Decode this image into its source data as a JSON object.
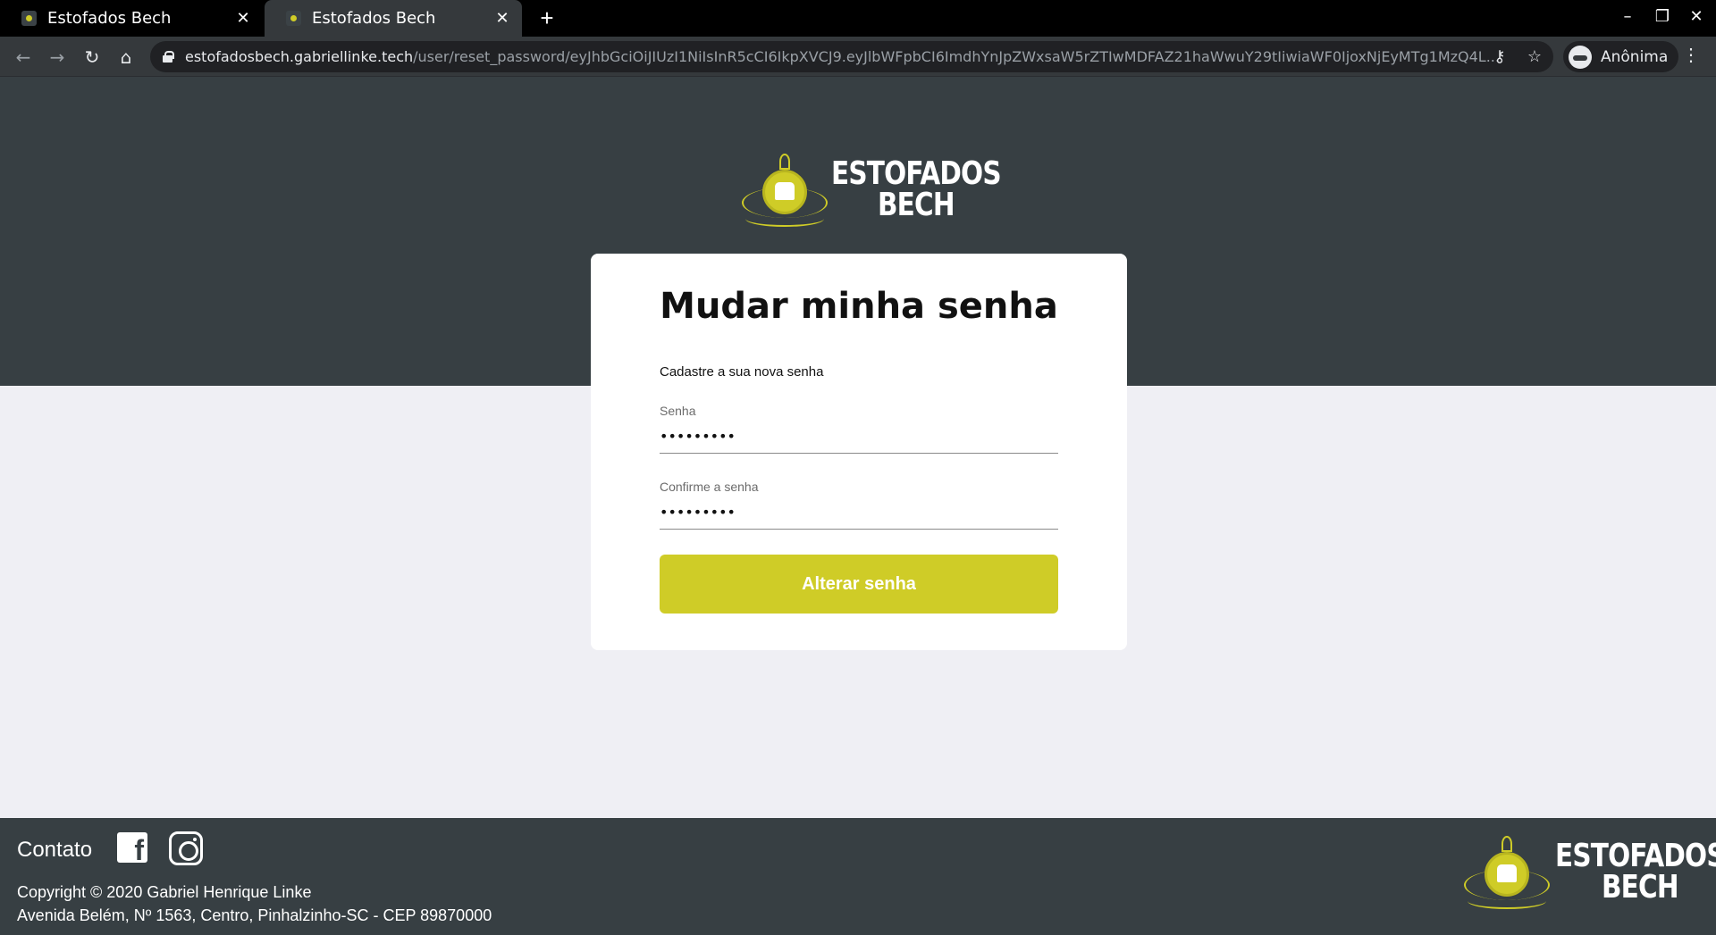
{
  "browser": {
    "tabs": [
      {
        "title": "Estofados Bech",
        "active": false
      },
      {
        "title": "Estofados Bech",
        "active": true
      }
    ],
    "new_tab_label": "+",
    "url_host": "estofadosbech.gabriellinke.tech",
    "url_path": "/user/reset_password/eyJhbGciOiJIUzI1NiIsInR5cCI6IkpXVCJ9.eyJlbWFpbCI6ImdhYnJpZWxsaW5rZTIwMDFAZ21haWwuY29tIiwiaWF0IjoxNjEyMTg1MzQ4L...",
    "profile_label": "Anônima"
  },
  "brand": {
    "line1": "ESTOFADOS",
    "line2": "BECH"
  },
  "form": {
    "title": "Mudar minha senha",
    "subtitle": "Cadastre a sua nova senha",
    "password_label": "Senha",
    "password_value": "•••••••••",
    "confirm_label": "Confirme a senha",
    "confirm_value": "•••••••••",
    "submit_label": "Alterar senha"
  },
  "footer": {
    "contact_label": "Contato",
    "copyright": "Copyright © 2020 Gabriel Henrique Linke",
    "address": "Avenida Belém, Nº 1563, Centro, Pinhalzinho-SC - CEP 89870000"
  },
  "icons": [
    "favicon-icon",
    "close-icon",
    "back-icon",
    "forward-icon",
    "reload-icon",
    "home-icon",
    "lock-icon",
    "key-icon",
    "star-icon",
    "incognito-icon",
    "menu-icon",
    "facebook-icon",
    "instagram-icon"
  ],
  "colors": {
    "accent": "#cfcc27",
    "dark": "#373f43",
    "background": "#efeff4"
  }
}
